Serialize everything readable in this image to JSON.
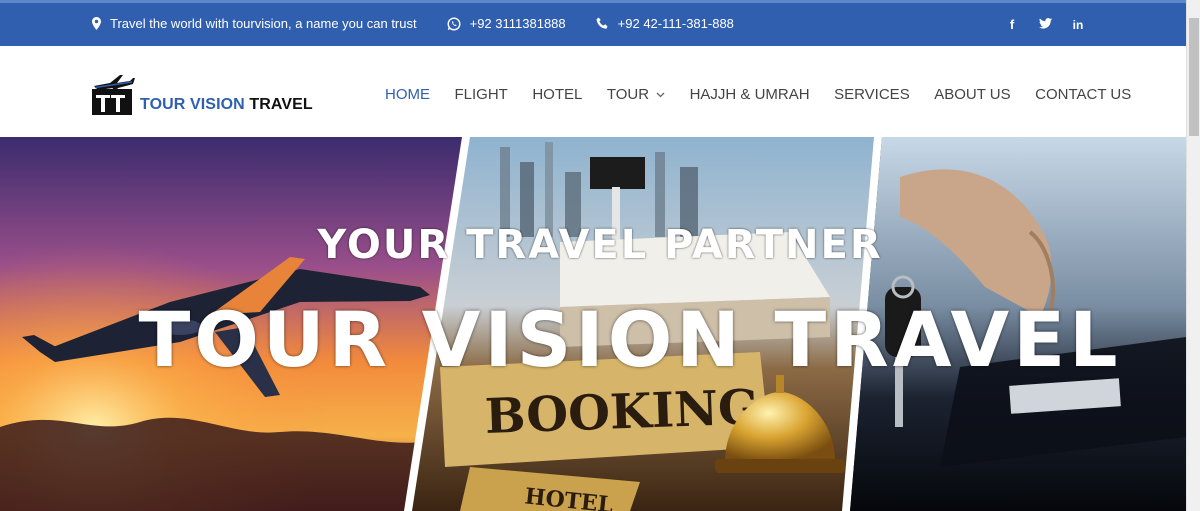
{
  "topbar": {
    "tagline": "Travel the world with tourvision, a name you can trust",
    "whatsapp": "+92 3111381888",
    "phone": "+92 42-111-381-888",
    "social": [
      "f",
      "t",
      "in"
    ]
  },
  "logo": {
    "part1": "TOUR VISION",
    "part2": " TRAVEL"
  },
  "nav": {
    "items": [
      "HOME",
      "FLIGHT",
      "HOTEL",
      "TOUR",
      "HAJJH & UMRAH",
      "SERVICES",
      "ABOUT US",
      "CONTACT US"
    ],
    "active": "HOME"
  },
  "hero": {
    "tagline": "YOUR TRAVEL PARTNER",
    "title": "TOUR VISION TRAVEL",
    "panel_texts": {
      "booking_sign": "BOOKING",
      "hotel_tag": "HOTEL"
    }
  },
  "colors": {
    "brand_blue": "#2f5fae",
    "topbar_bg": "#2f5fae",
    "nav_text": "#444444"
  },
  "icons": [
    "map-pin-icon",
    "whatsapp-icon",
    "phone-icon",
    "facebook-icon",
    "twitter-icon",
    "linkedin-icon",
    "chevron-down-icon",
    "plane-logo-icon"
  ]
}
